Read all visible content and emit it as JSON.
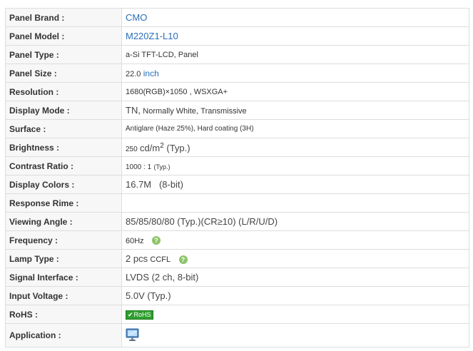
{
  "rows": [
    {
      "label": "Panel Brand :",
      "value": "CMO"
    },
    {
      "label": "Panel Model :",
      "value": "M220Z1-L10"
    },
    {
      "label": "Panel Type :",
      "value": "a-Si TFT-LCD, Panel"
    },
    {
      "label": "Panel Size :",
      "value_num": "22.0",
      "value_unit": "inch"
    },
    {
      "label": "Resolution :",
      "value": "1680(RGB)×1050 , WSXGA+"
    },
    {
      "label": "Display Mode :",
      "value_a": "TN,",
      "value_b": "Normally White,",
      "value_c": "Transmissive"
    },
    {
      "label": "Surface :",
      "value": "Antiglare (Haze 25%), Hard coating (3H)"
    },
    {
      "label": "Brightness :",
      "value_num": "250",
      "value_unit": "cd/m",
      "value_sup": "2",
      "value_suffix": " (Typ.)"
    },
    {
      "label": "Contrast Ratio :",
      "value_num": "1000 : 1",
      "value_suffix": "(Typ.)"
    },
    {
      "label": "Display Colors :",
      "value": "16.7M   (8-bit)"
    },
    {
      "label": "Response Rime :",
      "value": ""
    },
    {
      "label": "Viewing Angle :",
      "value": "85/85/80/80 (Typ.)(CR≥10) (L/R/U/D)"
    },
    {
      "label": "Frequency :",
      "value": "60Hz"
    },
    {
      "label": "Lamp Type :",
      "value_a": "2 pcs",
      "value_b": "CCFL"
    },
    {
      "label": "Signal Interface :",
      "value": "LVDS (2 ch, 8-bit)"
    },
    {
      "label": "Input Voltage :",
      "value": "5.0V (Typ.)"
    },
    {
      "label": "RoHS :",
      "badge": "RoHS"
    },
    {
      "label": "Application :",
      "icon": "monitor-icon"
    }
  ],
  "help_icon_glyph": "?"
}
